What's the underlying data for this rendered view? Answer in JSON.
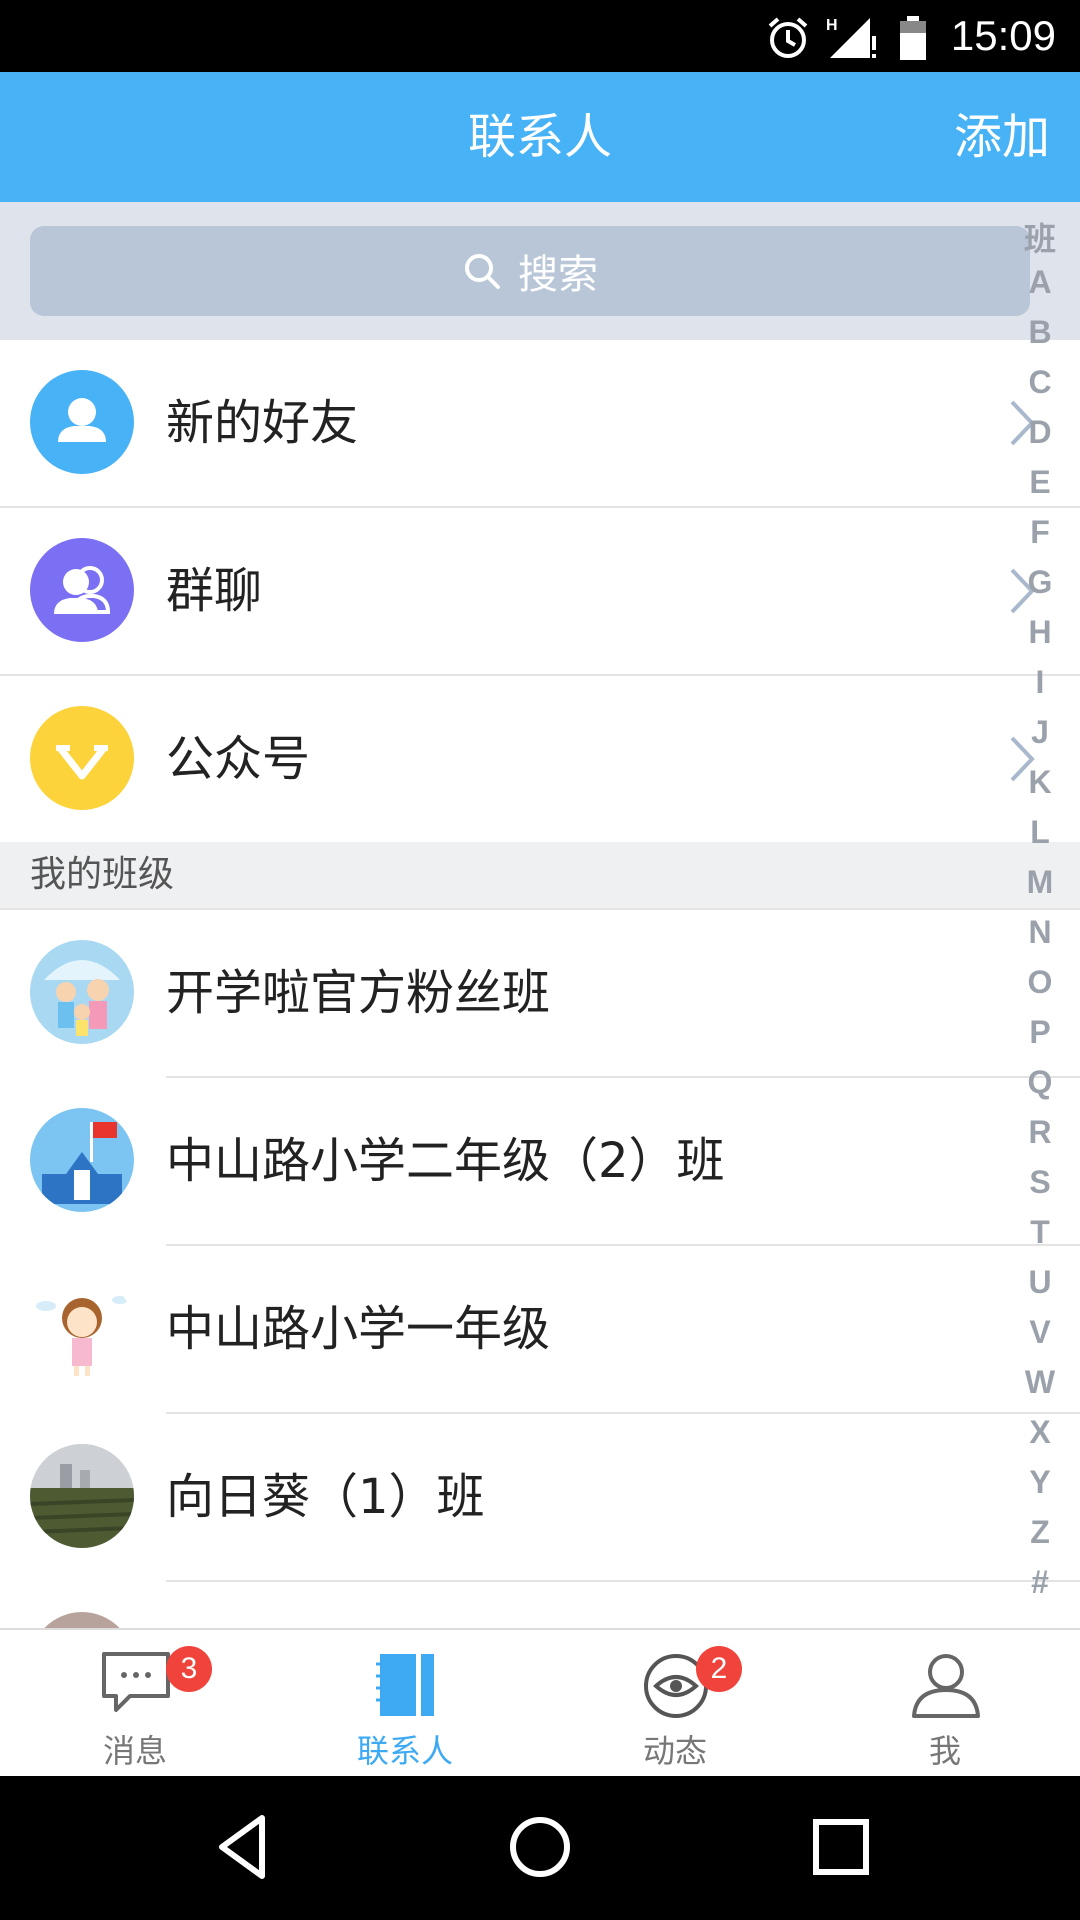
{
  "status_bar": {
    "time": "15:09",
    "icons": [
      "alarm-icon",
      "signal-h-icon",
      "battery-icon"
    ]
  },
  "app_bar": {
    "title": "联系人",
    "action_label": "添加"
  },
  "search": {
    "placeholder": "搜索",
    "icon": "search-icon"
  },
  "shortcuts": [
    {
      "label": "新的好友",
      "icon": "new-friend-icon",
      "color": "#47b2f6"
    },
    {
      "label": "群聊",
      "icon": "group-chat-icon",
      "color": "#7b70f3"
    },
    {
      "label": "公众号",
      "icon": "official-account-icon",
      "color": "#fcd33a"
    }
  ],
  "section": {
    "title": "我的班级"
  },
  "classes": [
    {
      "name": "开学啦官方粉丝班",
      "avatar": "family-umbrella-avatar"
    },
    {
      "name": "中山路小学二年级（2）班",
      "avatar": "school-flag-avatar"
    },
    {
      "name": "中山路小学一年级",
      "avatar": "girl-avatar"
    },
    {
      "name": "向日葵（1）班",
      "avatar": "field-photo-avatar"
    }
  ],
  "index_letters": [
    "班",
    "A",
    "B",
    "C",
    "D",
    "E",
    "F",
    "G",
    "H",
    "I",
    "J",
    "K",
    "L",
    "M",
    "N",
    "O",
    "P",
    "Q",
    "R",
    "S",
    "T",
    "U",
    "V",
    "W",
    "X",
    "Y",
    "Z",
    "#"
  ],
  "tabs": [
    {
      "label": "消息",
      "icon": "message-icon",
      "badge": "3",
      "active": false
    },
    {
      "label": "联系人",
      "icon": "contacts-book-icon",
      "badge": "",
      "active": true
    },
    {
      "label": "动态",
      "icon": "moments-eye-icon",
      "badge": "2",
      "active": false
    },
    {
      "label": "我",
      "icon": "profile-icon",
      "badge": "",
      "active": false
    }
  ],
  "colors": {
    "primary": "#47b2f6",
    "badge": "#f0433c",
    "search_bg": "#b8c6d7"
  }
}
